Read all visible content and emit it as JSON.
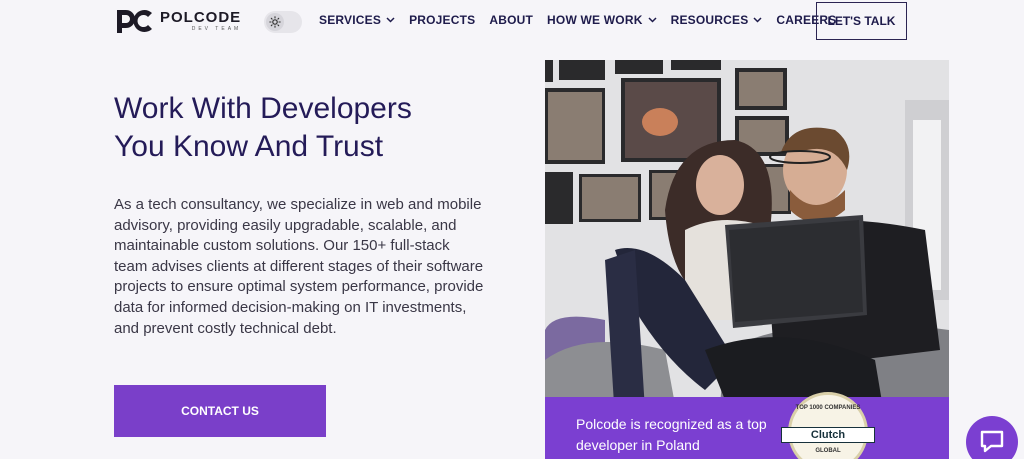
{
  "brand": {
    "name": "POLCODE",
    "subtitle": "DEV TEAM",
    "accent": "#7b3fd1",
    "navy": "#241b58"
  },
  "nav": {
    "items": [
      {
        "label": "SERVICES",
        "dropdown": true
      },
      {
        "label": "PROJECTS",
        "dropdown": false
      },
      {
        "label": "ABOUT",
        "dropdown": false
      },
      {
        "label": "HOW WE WORK",
        "dropdown": true
      },
      {
        "label": "RESOURCES",
        "dropdown": true
      },
      {
        "label": "CAREERS",
        "dropdown": false
      }
    ],
    "cta_label": "LET'S TALK",
    "theme_toggle_icon": "sun-icon"
  },
  "hero": {
    "title_line1": "Work With Developers",
    "title_line2": "You Know And Trust",
    "body": "As a tech consultancy, we specialize in web and mobile advisory, providing easily upgradable, scalable, and maintainable custom solutions. Our 150+ full-stack team advises clients at different stages of their software projects to ensure optimal system performance, provide data for informed decision-making on IT investments, and prevent costly technical debt.",
    "cta_label": "CONTACT US"
  },
  "recognition": {
    "text": "Polcode is recognized as a top developer in Poland",
    "badge": {
      "top": "TOP 1000 COMPANIES",
      "brand": "Clutch",
      "bottom": "GLOBAL"
    }
  },
  "chat": {
    "icon": "chat-bubble-icon"
  }
}
